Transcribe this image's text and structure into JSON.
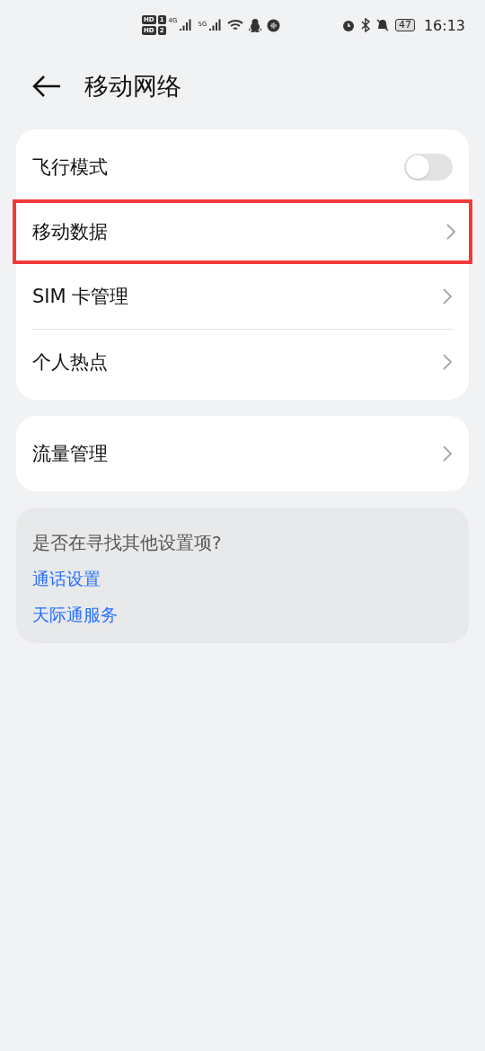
{
  "status_bar": {
    "sims": [
      {
        "hd": "HD",
        "slot": "1",
        "network": "4G"
      },
      {
        "hd": "HD",
        "slot": "2",
        "network": "5G"
      }
    ],
    "battery": "47",
    "time": "16:13"
  },
  "header": {
    "title": "移动网络"
  },
  "groups": [
    {
      "items": [
        {
          "label": "飞行模式",
          "kind": "switch",
          "on": false,
          "highlighted": false
        },
        {
          "label": "移动数据",
          "kind": "link",
          "highlighted": true
        },
        {
          "label": "SIM 卡管理",
          "kind": "link",
          "highlighted": false
        },
        {
          "label": "个人热点",
          "kind": "link",
          "highlighted": false
        }
      ]
    },
    {
      "items": [
        {
          "label": "流量管理",
          "kind": "link",
          "highlighted": false
        }
      ]
    }
  ],
  "suggestions": {
    "title": "是否在寻找其他设置项?",
    "links": [
      "通话设置",
      "天际通服务"
    ]
  }
}
